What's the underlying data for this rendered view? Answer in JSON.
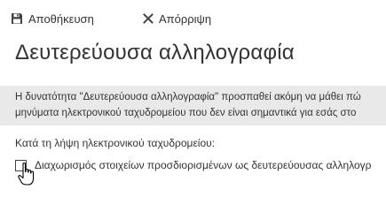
{
  "toolbar": {
    "save_label": "Αποθήκευση",
    "discard_label": "Απόρριψη",
    "save_icon": "floppy-disk-icon",
    "discard_icon": "x-close-icon"
  },
  "page": {
    "title": "Δευτερεύουσα αλληλογραφία"
  },
  "info": {
    "line1": "Η δυνατότητα \"Δευτερεύουσα αλληλογραφία\" προσπαθεί ακόμη να μάθει πώ",
    "line2": "μηνύματα ηλεκτρονικού ταχυδρομείου που δεν είναι σημαντικά για εσάς στο"
  },
  "section": {
    "label": "Κατά τη λήψη ηλεκτρονικού ταχυδρομείου:"
  },
  "option": {
    "checked": false,
    "label": "Διαχωρισμός στοιχείων προσδιορισμένων ως δευτερεύουσας αλληλογρ"
  },
  "colors": {
    "info_background": "#e9e9e9",
    "text": "#333333"
  },
  "cursor_icon": "hand-pointer-icon"
}
